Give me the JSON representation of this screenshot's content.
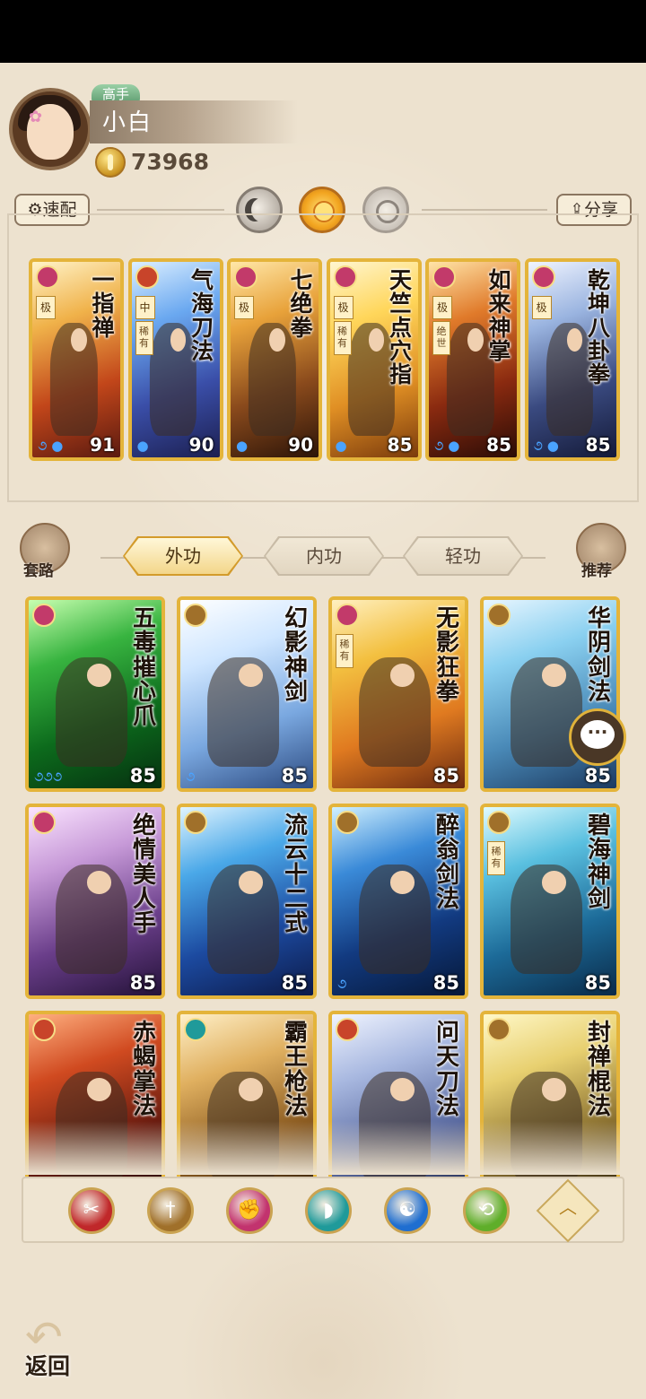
{
  "profile": {
    "rank": "高手",
    "name": "小白",
    "coins": "73968"
  },
  "toolbar": {
    "quick_label": "速配",
    "share_label": "分享",
    "modes": [
      "moon",
      "sun",
      "halo"
    ]
  },
  "equipped": [
    {
      "title": "一指禅",
      "tier": "极",
      "level": "91",
      "type_color": "#c23a6a",
      "tag": ""
    },
    {
      "title": "气海刀法",
      "tier": "中",
      "level": "90",
      "type_color": "#c8442a",
      "tag": "稀有"
    },
    {
      "title": "七绝拳",
      "tier": "极",
      "level": "90",
      "type_color": "#c23a6a",
      "tag": ""
    },
    {
      "title": "天竺点穴指",
      "tier": "极",
      "level": "85",
      "type_color": "#c23a6a",
      "tag": "稀有"
    },
    {
      "title": "如来神掌",
      "tier": "极",
      "level": "85",
      "type_color": "#c23a6a",
      "tag": "绝世"
    },
    {
      "title": "乾坤八卦拳",
      "tier": "极",
      "level": "85",
      "type_color": "#c23a6a",
      "tag": ""
    }
  ],
  "tabs": {
    "route_label": "套路",
    "recommend_label": "推荐",
    "items": [
      {
        "label": "外功",
        "active": true
      },
      {
        "label": "内功",
        "active": false
      },
      {
        "label": "轻功",
        "active": false
      }
    ]
  },
  "skills": [
    {
      "title": "五毒摧心爪",
      "level": "85",
      "tag": ""
    },
    {
      "title": "幻影神剑",
      "level": "85",
      "tag": ""
    },
    {
      "title": "无影狂拳",
      "level": "85",
      "tag": "稀有"
    },
    {
      "title": "华阴剑法",
      "level": "85",
      "tag": ""
    },
    {
      "title": "绝情美人手",
      "level": "85",
      "tag": ""
    },
    {
      "title": "流云十二式",
      "level": "85",
      "tag": ""
    },
    {
      "title": "醉翁剑法",
      "level": "85",
      "tag": ""
    },
    {
      "title": "碧海神剑",
      "level": "85",
      "tag": "稀有"
    },
    {
      "title": "赤蝎掌法",
      "level": "",
      "tag": ""
    },
    {
      "title": "霸王枪法",
      "level": "",
      "tag": ""
    },
    {
      "title": "问天刀法",
      "level": "",
      "tag": ""
    },
    {
      "title": "封禅棍法",
      "level": "",
      "tag": ""
    }
  ],
  "filters": [
    {
      "icon": "blade-icon",
      "color": "#c0282a"
    },
    {
      "icon": "sword-icon",
      "color": "#a0702a"
    },
    {
      "icon": "fist-icon",
      "color": "#c2336e"
    },
    {
      "icon": "fan-icon",
      "color": "#1f9a9a"
    },
    {
      "icon": "yinyang-icon",
      "color": "#1f6ed0"
    },
    {
      "icon": "staff-icon",
      "color": "#5fae2a"
    }
  ],
  "back_label": "返回"
}
